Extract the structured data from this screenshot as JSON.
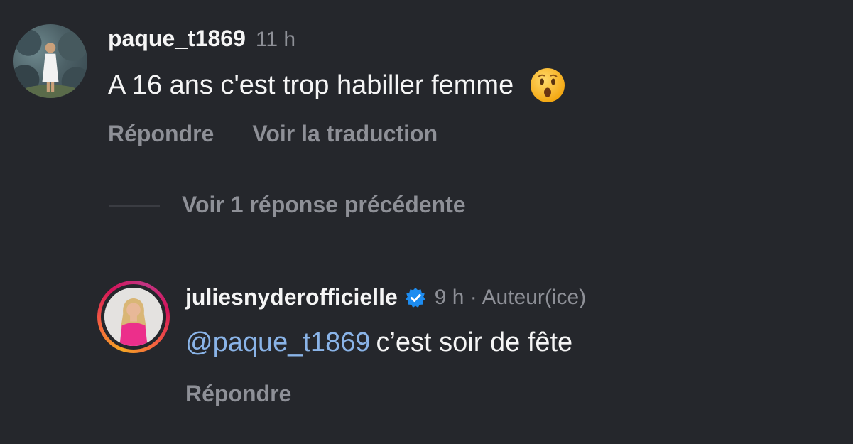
{
  "comment": {
    "username": "paque_t1869",
    "time": "11 h",
    "text": "A 16 ans c'est trop habiller femme",
    "emoji_icon": "hushed-face-emoji",
    "reply_label": "Répondre",
    "translate_label": "Voir la traduction"
  },
  "previous_replies": {
    "label": "Voir 1 réponse précédente"
  },
  "reply": {
    "username": "juliesnyderofficielle",
    "verified": true,
    "meta": "9 h · Auteur(ice)",
    "mention": "@paque_t1869",
    "text": "c’est soir de fête",
    "reply_label": "Répondre"
  },
  "colors": {
    "background": "#25272c",
    "primary_text": "#f5f5f5",
    "secondary_text": "#8e9097",
    "mention": "#8ab4e8",
    "verified_badge": "#1d8cf0"
  }
}
